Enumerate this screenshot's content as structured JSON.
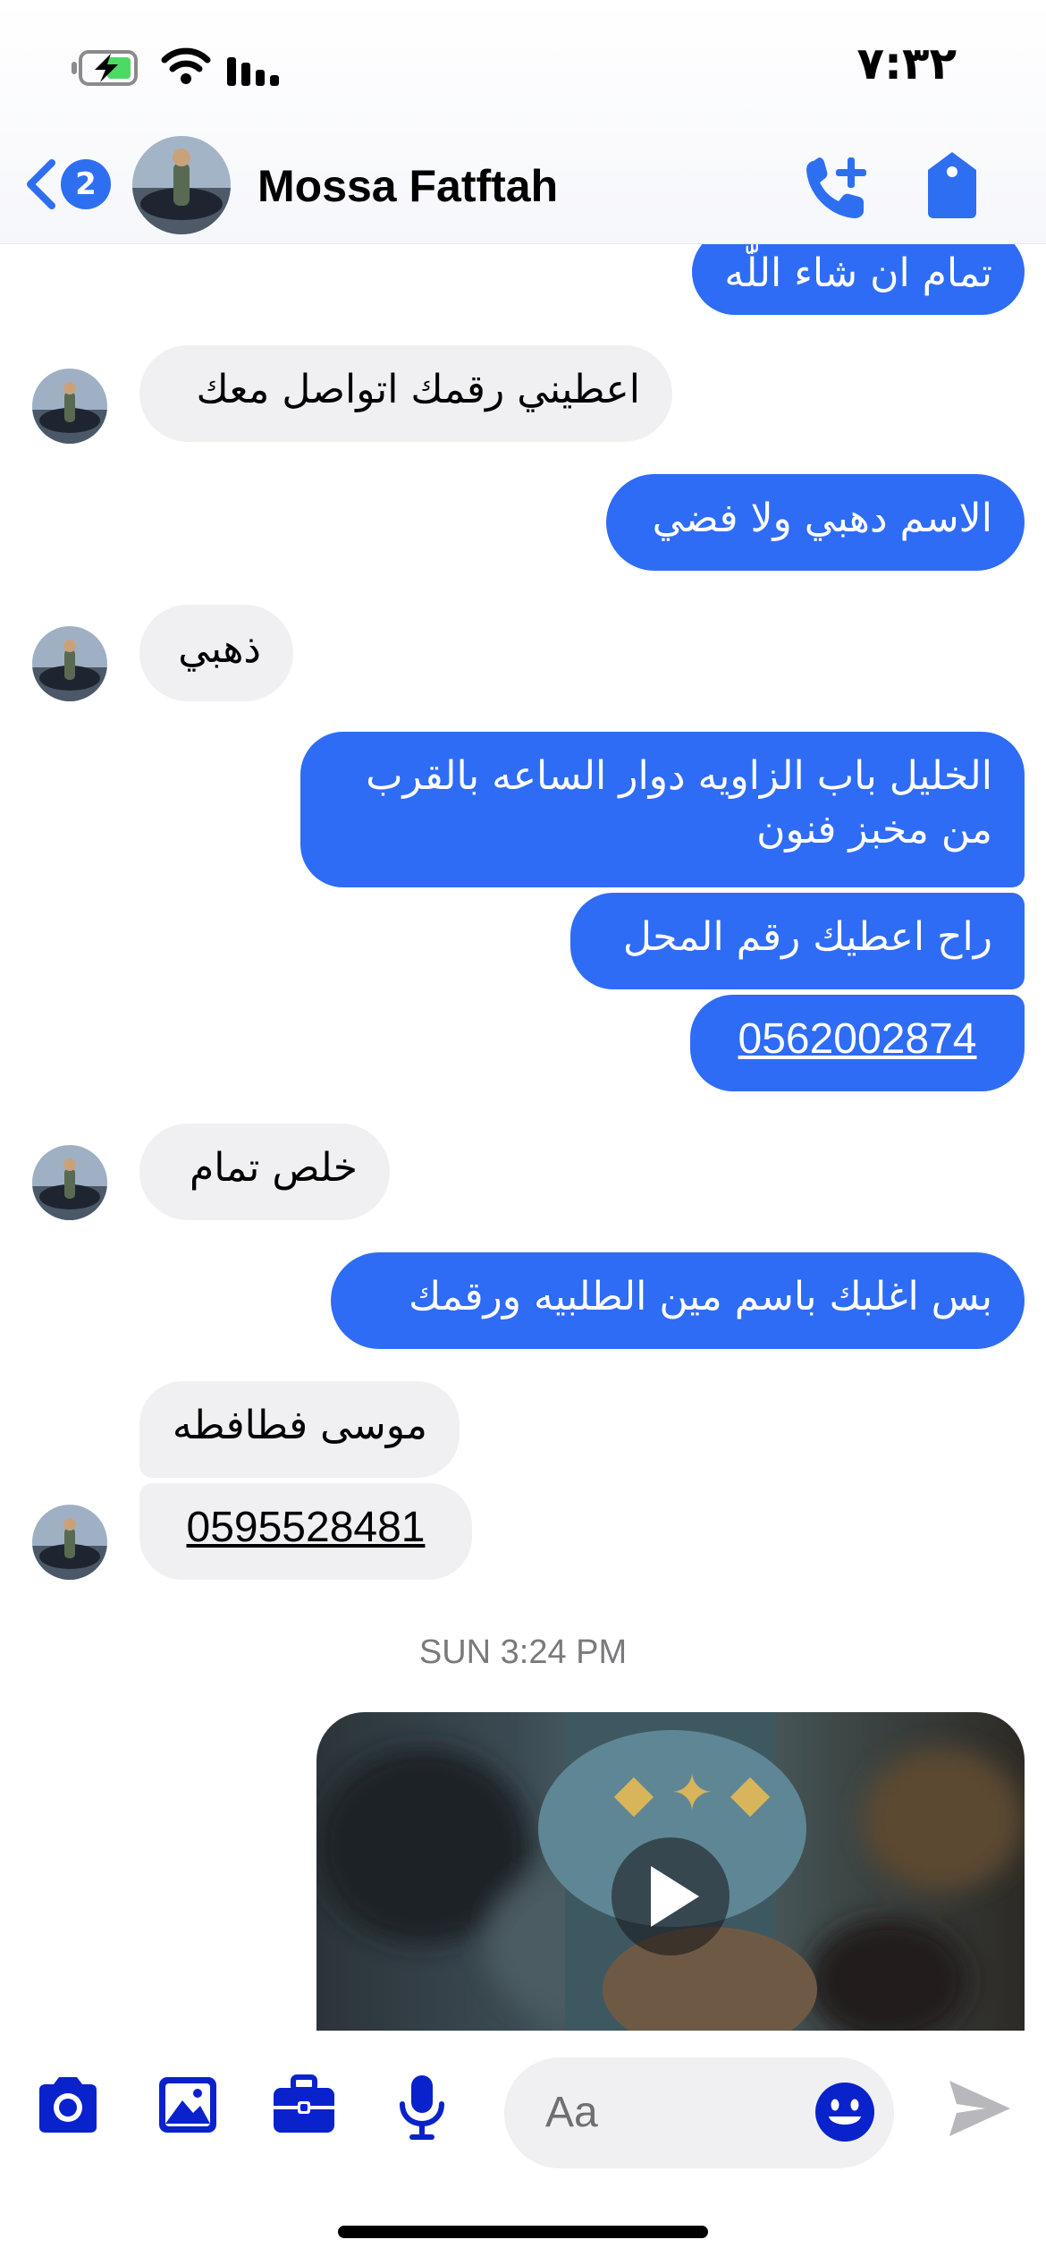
{
  "status_bar": {
    "time": "٧:٣٢"
  },
  "header": {
    "back_badge_count": "2",
    "contact_name": "Mossa Fatftah",
    "call_icon": "phone-plus-icon",
    "tag_icon": "tag-icon"
  },
  "messages": [
    {
      "side": "out",
      "text": "تمام ان شاء اللّٰه"
    },
    {
      "side": "in",
      "text": "اعطيني رقمك اتواصل معك"
    },
    {
      "side": "out",
      "text": "الاسم دهبي ولا فضي"
    },
    {
      "side": "in",
      "text": "ذهبي"
    },
    {
      "side": "out",
      "lines": [
        "الخليل باب الزاويه دوار الساعه بالقرب",
        "من مخبز فنون"
      ]
    },
    {
      "side": "out",
      "text": "راح اعطيك رقم المحل"
    },
    {
      "side": "out",
      "text": "0562002874",
      "link": true
    },
    {
      "side": "in",
      "text": "خلص تمام"
    },
    {
      "side": "out",
      "text": "بس اغلبك باسم مين الطلبيه ورقمك"
    },
    {
      "side": "in",
      "text": "موسى فطافطه"
    },
    {
      "side": "in",
      "text": "0595528481",
      "link": true
    }
  ],
  "timestamp": "SUN 3:24 PM",
  "video_message": {
    "icon": "play-icon"
  },
  "composer": {
    "placeholder": "Aa",
    "icons": [
      "camera-icon",
      "image-icon",
      "briefcase-icon",
      "microphone-icon",
      "emoji-icon",
      "send-icon"
    ]
  },
  "colors": {
    "accent": "#2f6cf5",
    "incoming_bubble": "#f0f0f2",
    "composer_icons": "#0a22cc",
    "battery_charge": "#4cd964"
  }
}
